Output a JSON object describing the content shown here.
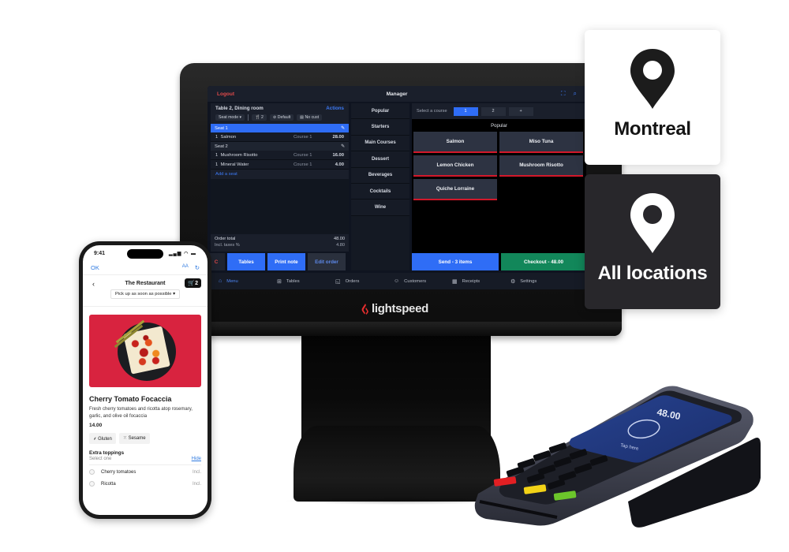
{
  "pos": {
    "topbar": {
      "logout": "Logout",
      "title": "Manager",
      "scan_icon": "scan-icon",
      "search_icon": "search-icon"
    },
    "order": {
      "table": "Table 2, Dining room",
      "actions": "Actions",
      "seat_mode": "Seat mode ▾",
      "guests": "2",
      "default": "Default",
      "customer": "No cust",
      "seats": [
        {
          "label": "Seat 1",
          "items": [
            {
              "qty": "1",
              "name": "Salmon",
              "course": "Course 1",
              "price": "28.00"
            }
          ]
        },
        {
          "label": "Seat 2",
          "items": [
            {
              "qty": "1",
              "name": "Mushroom Risotto",
              "course": "Course 1",
              "price": "16.00"
            },
            {
              "qty": "1",
              "name": "Mineral Water",
              "course": "Course 1",
              "price": "4.00"
            }
          ]
        }
      ],
      "add_seat": "Add a seat",
      "order_total_label": "Order total",
      "order_total": "48.00",
      "taxes_label": "Incl. taxes %",
      "taxes": "4.80"
    },
    "buttons": {
      "clear": "C",
      "tables": "Tables",
      "print_note": "Print note",
      "edit_order": "Edit order",
      "send": "Send - 3 items",
      "checkout": "Checkout - 48.00"
    },
    "categories": [
      "Popular",
      "Starters",
      "Main Courses",
      "Dessert",
      "Beverages",
      "Cocktails",
      "Wine"
    ],
    "course": {
      "label": "Select a course",
      "options": [
        "1",
        "2",
        "+"
      ],
      "selected": "1"
    },
    "section_title": "Popular",
    "menu_items": [
      "Salmon",
      "Miso Tuna",
      "Lemon Chicken",
      "Mushroom Risotto",
      "Quiche Lorraine"
    ],
    "nav": [
      {
        "label": "Menu",
        "icon": "menu-icon",
        "active": true
      },
      {
        "label": "Tables",
        "icon": "tables-icon"
      },
      {
        "label": "Orders",
        "icon": "orders-icon"
      },
      {
        "label": "Customers",
        "icon": "customers-icon"
      },
      {
        "label": "Receipts",
        "icon": "receipts-icon"
      },
      {
        "label": "Settings",
        "icon": "settings-icon"
      }
    ],
    "brand": "lightspeed"
  },
  "locations": [
    {
      "label": "Montreal",
      "theme": "light"
    },
    {
      "label": "All locations",
      "theme": "dark"
    }
  ],
  "phone": {
    "time": "9:41",
    "browser": {
      "ok": "OK",
      "text_size": "AA",
      "reload_icon": "reload-icon"
    },
    "restaurant": "The Restaurant",
    "cart_count": "2",
    "pickup": "Pick up as soon as possible ▾",
    "dish": {
      "title": "Cherry Tomato Focaccia",
      "description": "Fresh cherry tomatoes and ricotta atop rosemary, garlic, and olive oil focaccia",
      "price": "14.00",
      "allergens": [
        "Gluten",
        "Sesame"
      ]
    },
    "extras": {
      "title": "Extra toppings",
      "subtitle": "Select one",
      "hide": "Hide",
      "options": [
        {
          "label": "Cherry tomatoes",
          "note": "Incl."
        },
        {
          "label": "Ricotta",
          "note": "Incl."
        }
      ]
    }
  },
  "payment_terminal": {
    "amount": "48.00",
    "prompt": "Tap here"
  },
  "colors": {
    "pos_blue": "#2f6df6",
    "checkout_green": "#12875a",
    "accent_red": "#d3182a",
    "card_dark": "#28272b"
  }
}
